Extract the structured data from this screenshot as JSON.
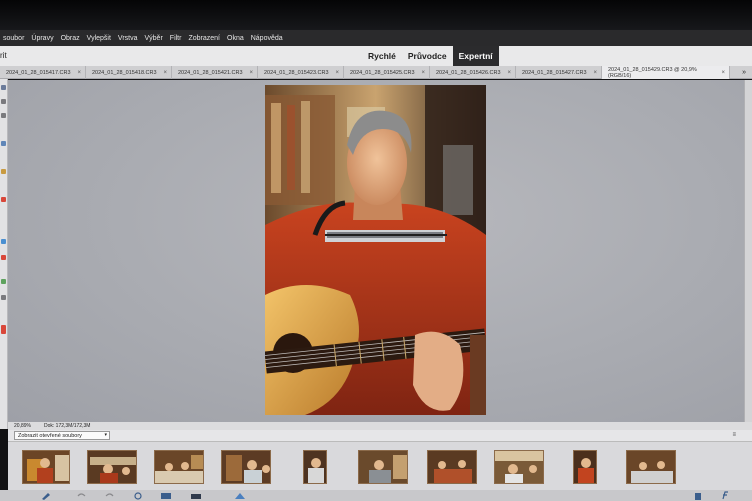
{
  "menu": {
    "items": [
      "soubor",
      "Úpravy",
      "Obraz",
      "Vylepšit",
      "Vrstva",
      "Výběr",
      "Filtr",
      "Zobrazení",
      "Okna",
      "Nápověda"
    ]
  },
  "modebar": {
    "left_label": "rit",
    "tabs": [
      {
        "label": "Rychlé",
        "active": false
      },
      {
        "label": "Průvodce",
        "active": false
      },
      {
        "label": "Expertní",
        "active": true
      }
    ]
  },
  "document_tabs": [
    {
      "label": "2024_01_28_015417.CR3",
      "active": false
    },
    {
      "label": "2024_01_28_015418.CR3",
      "active": false
    },
    {
      "label": "2024_01_28_015421.CR3",
      "active": false
    },
    {
      "label": "2024_01_28_015423.CR3",
      "active": false
    },
    {
      "label": "2024_01_28_015425.CR3",
      "active": false
    },
    {
      "label": "2024_01_28_015426.CR3",
      "active": false
    },
    {
      "label": "2024_01_28_015427.CR3",
      "active": false
    },
    {
      "label": "2024_01_28_015429.CR3 @ 20,9% (RGB/16)",
      "active": true
    }
  ],
  "tab_close_glyph": "×",
  "tabs_overflow": "»",
  "status": {
    "zoom": "20,89%",
    "doc": "Dok: 172,3M/172,3M"
  },
  "photo_bin": {
    "select_value": "Zobrazit otevřené soubory",
    "select_arrow": "▾",
    "options_glyph": "≡"
  },
  "icons": {
    "tabs_overflow": "double-chevron-right-icon",
    "select_arrow": "chevron-down-icon",
    "bin_options": "menu-lines-icon",
    "bottom_bar": [
      "brush-icon",
      "undo-icon",
      "redo-icon",
      "rotate-icon",
      "layout-icon",
      "organizer-icon",
      "home-icon",
      "trash-icon",
      "fx-icon"
    ]
  },
  "colors": {
    "menubar": "#2a2a2c",
    "mode_active": "#2b2b2d",
    "canvas": "#aeb0b6",
    "accent_tool": "#d9473a"
  }
}
